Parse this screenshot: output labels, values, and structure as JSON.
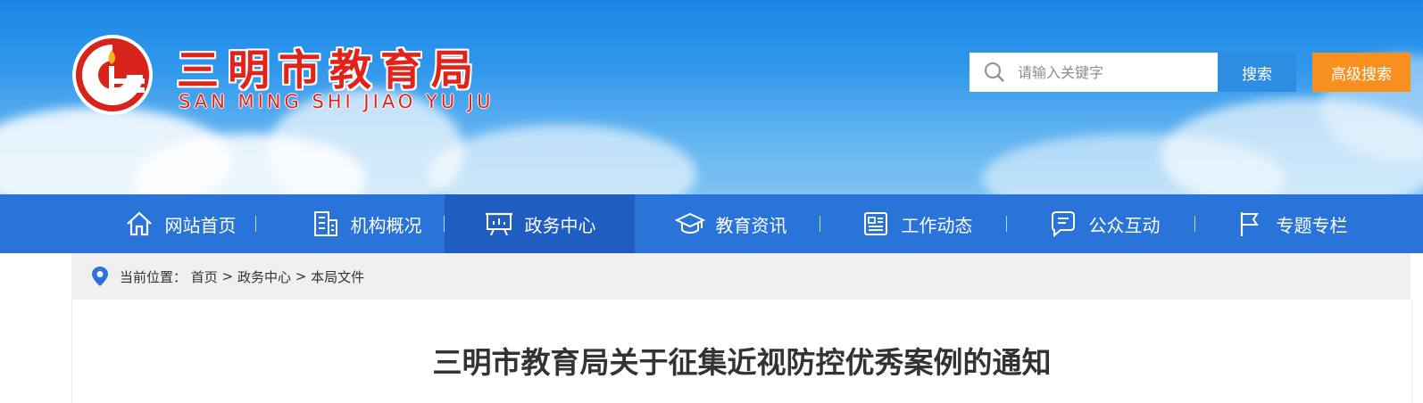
{
  "header": {
    "title": "三明市教育局",
    "subtitle": "SAN MING SHI JIAO YU JU",
    "brand_color": "#e2231a"
  },
  "search": {
    "placeholder": "请输入关键字",
    "value": "",
    "search_label": "搜索",
    "advanced_label": "高级搜索",
    "search_color": "#2c8de2",
    "advanced_color": "#f7901e"
  },
  "nav": {
    "color": "#2a73d9",
    "active_color": "#1f5ec0",
    "items": [
      {
        "label": "网站首页",
        "icon": "home-icon"
      },
      {
        "label": "机构概况",
        "icon": "building-icon"
      },
      {
        "label": "政务中心",
        "icon": "presentation-board-icon",
        "active": true
      },
      {
        "label": "教育资讯",
        "icon": "graduation-cap-icon"
      },
      {
        "label": "工作动态",
        "icon": "document-list-icon"
      },
      {
        "label": "公众互动",
        "icon": "chat-bubble-icon"
      },
      {
        "label": "专题专栏",
        "icon": "flag-icon"
      }
    ]
  },
  "breadcrumb": {
    "prefix": "当前位置：",
    "items": [
      "首页",
      "政务中心",
      "本局文件"
    ],
    "separator": ">"
  },
  "article": {
    "title": "三明市教育局关于征集近视防控优秀案例的通知"
  }
}
